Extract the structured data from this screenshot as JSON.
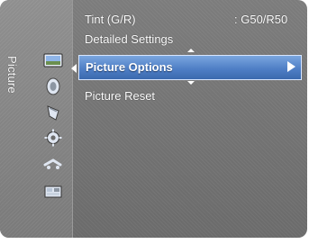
{
  "sidebar": {
    "title": "Picture",
    "icons": [
      "picture-icon",
      "sound-icon",
      "channel-icon",
      "setup-icon",
      "input-icon",
      "application-icon"
    ]
  },
  "menu": {
    "items": [
      {
        "label": "Tint (G/R)",
        "value": ": G50/R50"
      },
      {
        "label": "Detailed Settings"
      },
      {
        "label": "Picture Options",
        "selected": true,
        "has_submenu": true
      },
      {
        "label": "Picture Reset"
      }
    ]
  },
  "colors": {
    "highlight": "#4f7fc6",
    "background": "#6e6e6e",
    "text": "#ffffff"
  }
}
